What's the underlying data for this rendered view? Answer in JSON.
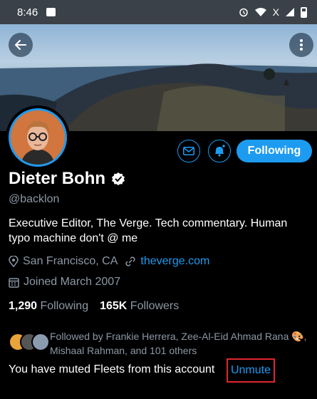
{
  "status_bar": {
    "time": "8:46",
    "signal_label": "X"
  },
  "banner": {
    "description_icon": "mountain-coastline-image"
  },
  "profile": {
    "name": "Dieter Bohn",
    "handle": "@backlon",
    "bio": "Executive Editor, The Verge. Tech commentary. Human typo machine don't @ me",
    "location": "San Francisco, CA",
    "website": "theverge.com",
    "joined": "Joined March 2007",
    "following_count": "1,290",
    "following_label": "Following",
    "followers_count": "165K",
    "followers_label": "Followers"
  },
  "actions": {
    "follow_label": "Following"
  },
  "followed_by": {
    "text": "Followed by Frankie Herrera, Zee-Al-Eid Ahmad Rana 🎨, Mishaal Rahman, and 101 others"
  },
  "muted": {
    "text": "You have muted Fleets from this account",
    "unmute_label": "Unmute"
  },
  "colors": {
    "accent": "#1d9bf0",
    "highlight": "#e0262a",
    "muted_text": "#8b98a5"
  }
}
